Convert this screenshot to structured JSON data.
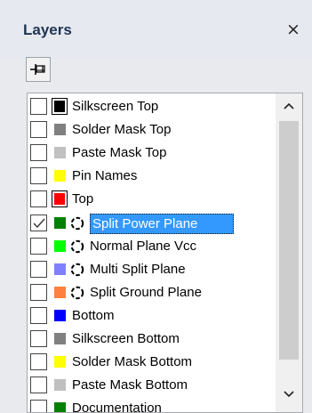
{
  "panel": {
    "title": "Layers",
    "close_glyph": "×",
    "pin_icon": "pin-icon"
  },
  "layers": [
    {
      "label": "Silkscreen Top",
      "checked": false,
      "color": "#000000",
      "style": "framed",
      "plane": false,
      "selected": false
    },
    {
      "label": "Solder Mask Top",
      "checked": false,
      "color": "#808080",
      "style": "plain",
      "plane": false,
      "selected": false
    },
    {
      "label": "Paste Mask Top",
      "checked": false,
      "color": "#c0c0c0",
      "style": "plain",
      "plane": false,
      "selected": false
    },
    {
      "label": "Pin Names",
      "checked": false,
      "color": "#ffff00",
      "style": "plain",
      "plane": false,
      "selected": false
    },
    {
      "label": "Top",
      "checked": false,
      "color": "#ff0000",
      "style": "framed",
      "plane": false,
      "selected": false
    },
    {
      "label": "Split Power Plane",
      "checked": true,
      "color": "#008000",
      "style": "plain",
      "plane": true,
      "selected": true
    },
    {
      "label": "Normal Plane Vcc",
      "checked": false,
      "color": "#00ff00",
      "style": "plain",
      "plane": true,
      "selected": false
    },
    {
      "label": "Multi Split Plane",
      "checked": false,
      "color": "#8080ff",
      "style": "plain",
      "plane": true,
      "selected": false
    },
    {
      "label": "Split Ground Plane",
      "checked": false,
      "color": "#ff8040",
      "style": "plain",
      "plane": true,
      "selected": false
    },
    {
      "label": "Bottom",
      "checked": false,
      "color": "#0000ff",
      "style": "plain",
      "plane": false,
      "selected": false
    },
    {
      "label": "Silkscreen Bottom",
      "checked": false,
      "color": "#808080",
      "style": "plain",
      "plane": false,
      "selected": false
    },
    {
      "label": "Solder Mask Bottom",
      "checked": false,
      "color": "#ffff00",
      "style": "plain",
      "plane": false,
      "selected": false
    },
    {
      "label": "Paste Mask Bottom",
      "checked": false,
      "color": "#c0c0c0",
      "style": "plain",
      "plane": false,
      "selected": false
    },
    {
      "label": "Documentation",
      "checked": false,
      "color": "#008000",
      "style": "plain",
      "plane": false,
      "selected": false
    }
  ]
}
